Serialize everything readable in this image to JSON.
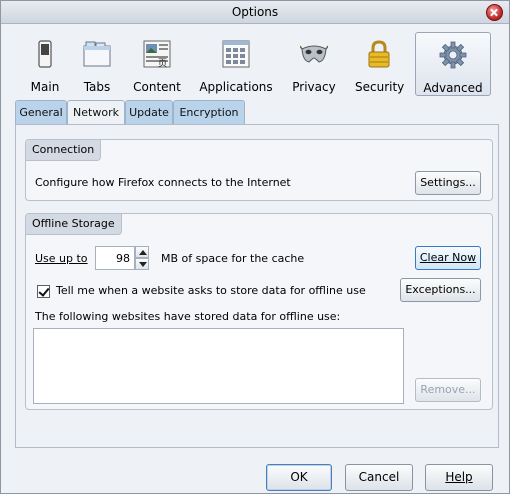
{
  "window": {
    "title": "Options"
  },
  "toolbar": {
    "panes": [
      {
        "label": "Main",
        "icon": "switch-icon"
      },
      {
        "label": "Tabs",
        "icon": "tabs-icon"
      },
      {
        "label": "Content",
        "icon": "content-icon"
      },
      {
        "label": "Applications",
        "icon": "applications-icon"
      },
      {
        "label": "Privacy",
        "icon": "mask-icon"
      },
      {
        "label": "Security",
        "icon": "padlock-icon"
      },
      {
        "label": "Advanced",
        "icon": "gear-icon"
      }
    ],
    "selected": "Advanced"
  },
  "tabs": [
    {
      "label": "General"
    },
    {
      "label": "Network"
    },
    {
      "label": "Update"
    },
    {
      "label": "Encryption"
    }
  ],
  "active_tab": "Network",
  "connection": {
    "caption": "Connection",
    "description": "Configure how Firefox connects to the Internet",
    "settings_button": "Settings..."
  },
  "offline_storage": {
    "caption": "Offline Storage",
    "use_up_to_label": "Use up to",
    "cache_size": "98",
    "cache_unit_label": "MB of space for the cache",
    "clear_now_button": "Clear Now",
    "tell_me_label": "Tell me when a website asks to store data for offline use",
    "tell_me_checked": true,
    "exceptions_button": "Exceptions...",
    "stored_sites_label": "The following websites have stored data for offline use:",
    "remove_button": "Remove..."
  },
  "footer": {
    "ok": "OK",
    "cancel": "Cancel",
    "help": "Help"
  },
  "colors": {
    "tab_bg": "#b9d3ea",
    "focus_border": "#3a7ab8"
  }
}
